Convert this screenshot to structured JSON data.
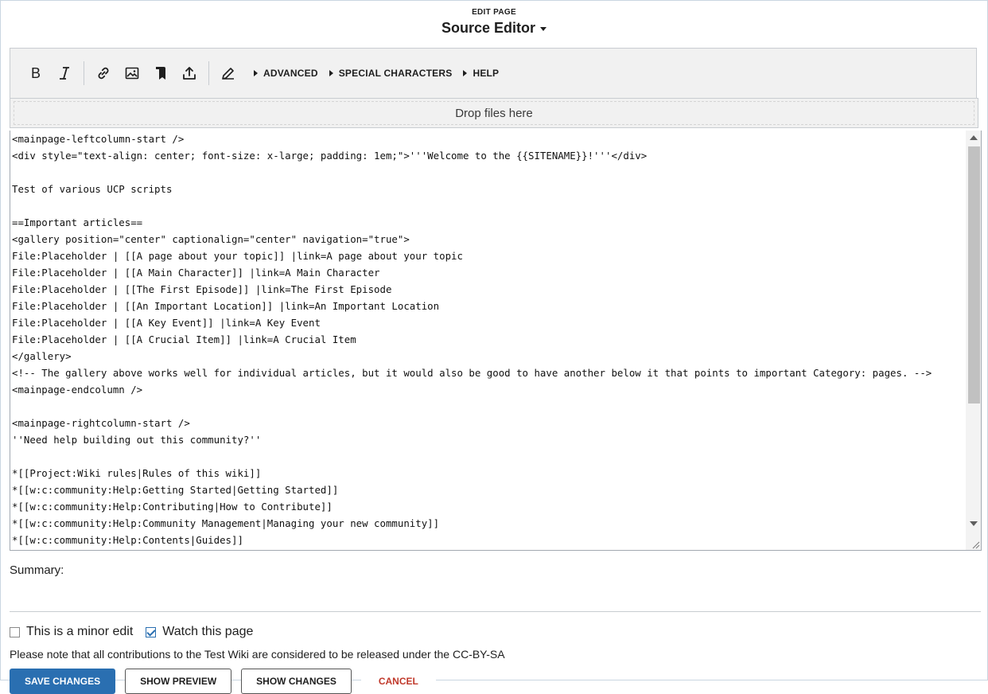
{
  "header": {
    "eyebrow": "EDIT PAGE",
    "title": "Source Editor"
  },
  "toolbar": {
    "buttons": [
      "bold-icon",
      "italic-icon",
      "link-icon",
      "image-icon",
      "bookmark-icon",
      "upload-icon",
      "pencil-icon"
    ],
    "menus": {
      "advanced": "ADVANCED",
      "special_characters": "SPECIAL CHARACTERS",
      "help": "HELP"
    }
  },
  "dropzone": {
    "text": "Drop files here"
  },
  "editor": {
    "lines": [
      "<mainpage-leftcolumn-start />",
      "<div style=\"text-align: center; font-size: x-large; padding: 1em;\">'''Welcome to the {{SITENAME}}!'''</div>",
      "",
      "Test of various UCP scripts",
      "",
      "==Important articles==",
      "<gallery position=\"center\" captionalign=\"center\" navigation=\"true\">",
      "File:Placeholder | [[A page about your topic]] |link=A page about your topic",
      "File:Placeholder | [[A Main Character]] |link=A Main Character",
      "File:Placeholder | [[The First Episode]] |link=The First Episode",
      "File:Placeholder | [[An Important Location]] |link=An Important Location",
      "File:Placeholder | [[A Key Event]] |link=A Key Event",
      "File:Placeholder | [[A Crucial Item]] |link=A Crucial Item",
      "</gallery>",
      "<!-- The gallery above works well for individual articles, but it would also be good to have another below it that points to important Category: pages. -->",
      "<mainpage-endcolumn />",
      "",
      "<mainpage-rightcolumn-start />",
      "''Need help building out this community?''",
      "",
      "*[[Project:Wiki rules|Rules of this wiki]]",
      "*[[w:c:community:Help:Getting Started|Getting Started]]",
      "*[[w:c:community:Help:Contributing|How to Contribute]]",
      "*[[w:c:community:Help:Community Management|Managing your new community]]",
      "*[[w:c:community:Help:Contents|Guides]]"
    ]
  },
  "summary": {
    "label": "Summary:",
    "value": ""
  },
  "options": {
    "minor_edit": {
      "label": "This is a minor edit",
      "checked": false
    },
    "watch_page": {
      "label": "Watch this page",
      "checked": true
    }
  },
  "license": "Please note that all contributions to the Test Wiki are considered to be released under the CC-BY-SA",
  "actions": {
    "save": "SAVE CHANGES",
    "preview": "SHOW PREVIEW",
    "changes": "SHOW CHANGES",
    "cancel": "CANCEL"
  },
  "colors": {
    "accent": "#2a6fb1",
    "cancel": "#c0392b",
    "toolbar_bg": "#f1f1f1"
  }
}
